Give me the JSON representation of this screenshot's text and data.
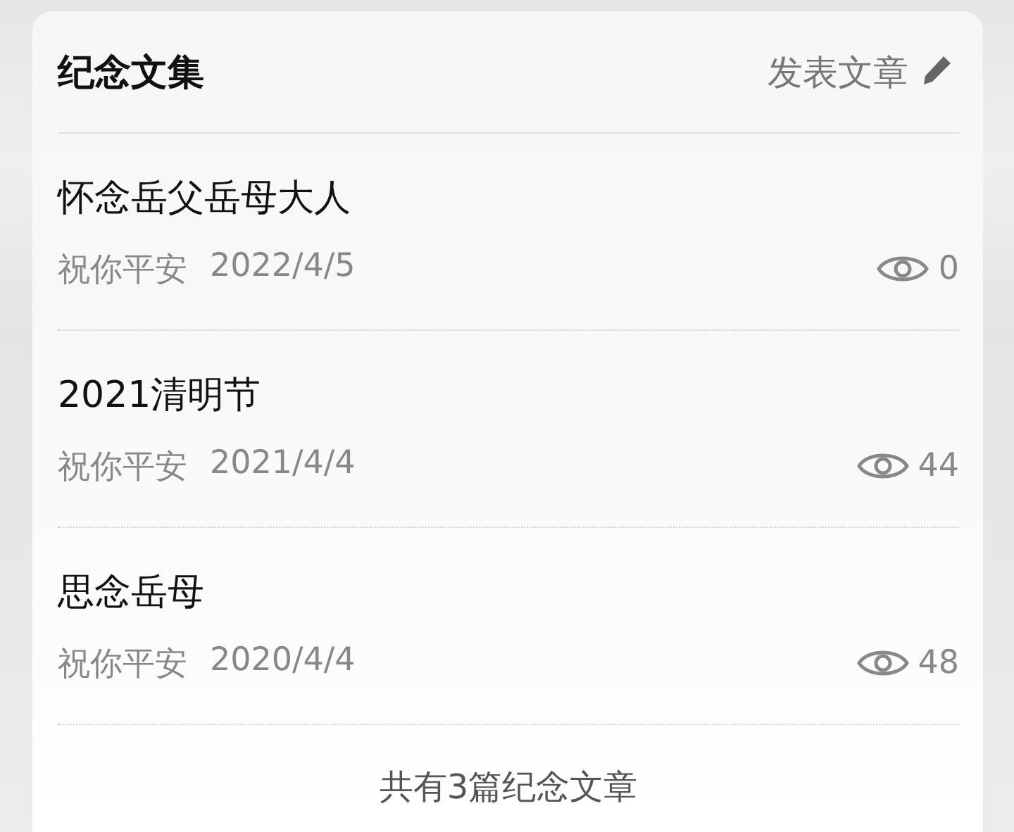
{
  "header": {
    "title": "纪念文集",
    "action": "发表文章"
  },
  "articles": [
    {
      "title": "怀念岳父岳母大人",
      "author": "祝你平安",
      "date": "2022/4/5",
      "views": "0"
    },
    {
      "title": "2021清明节",
      "author": "祝你平安",
      "date": "2021/4/4",
      "views": "44"
    },
    {
      "title": "思念岳母",
      "author": "祝你平安",
      "date": "2020/4/4",
      "views": "48"
    }
  ],
  "footer": "共有3篇纪念文章"
}
